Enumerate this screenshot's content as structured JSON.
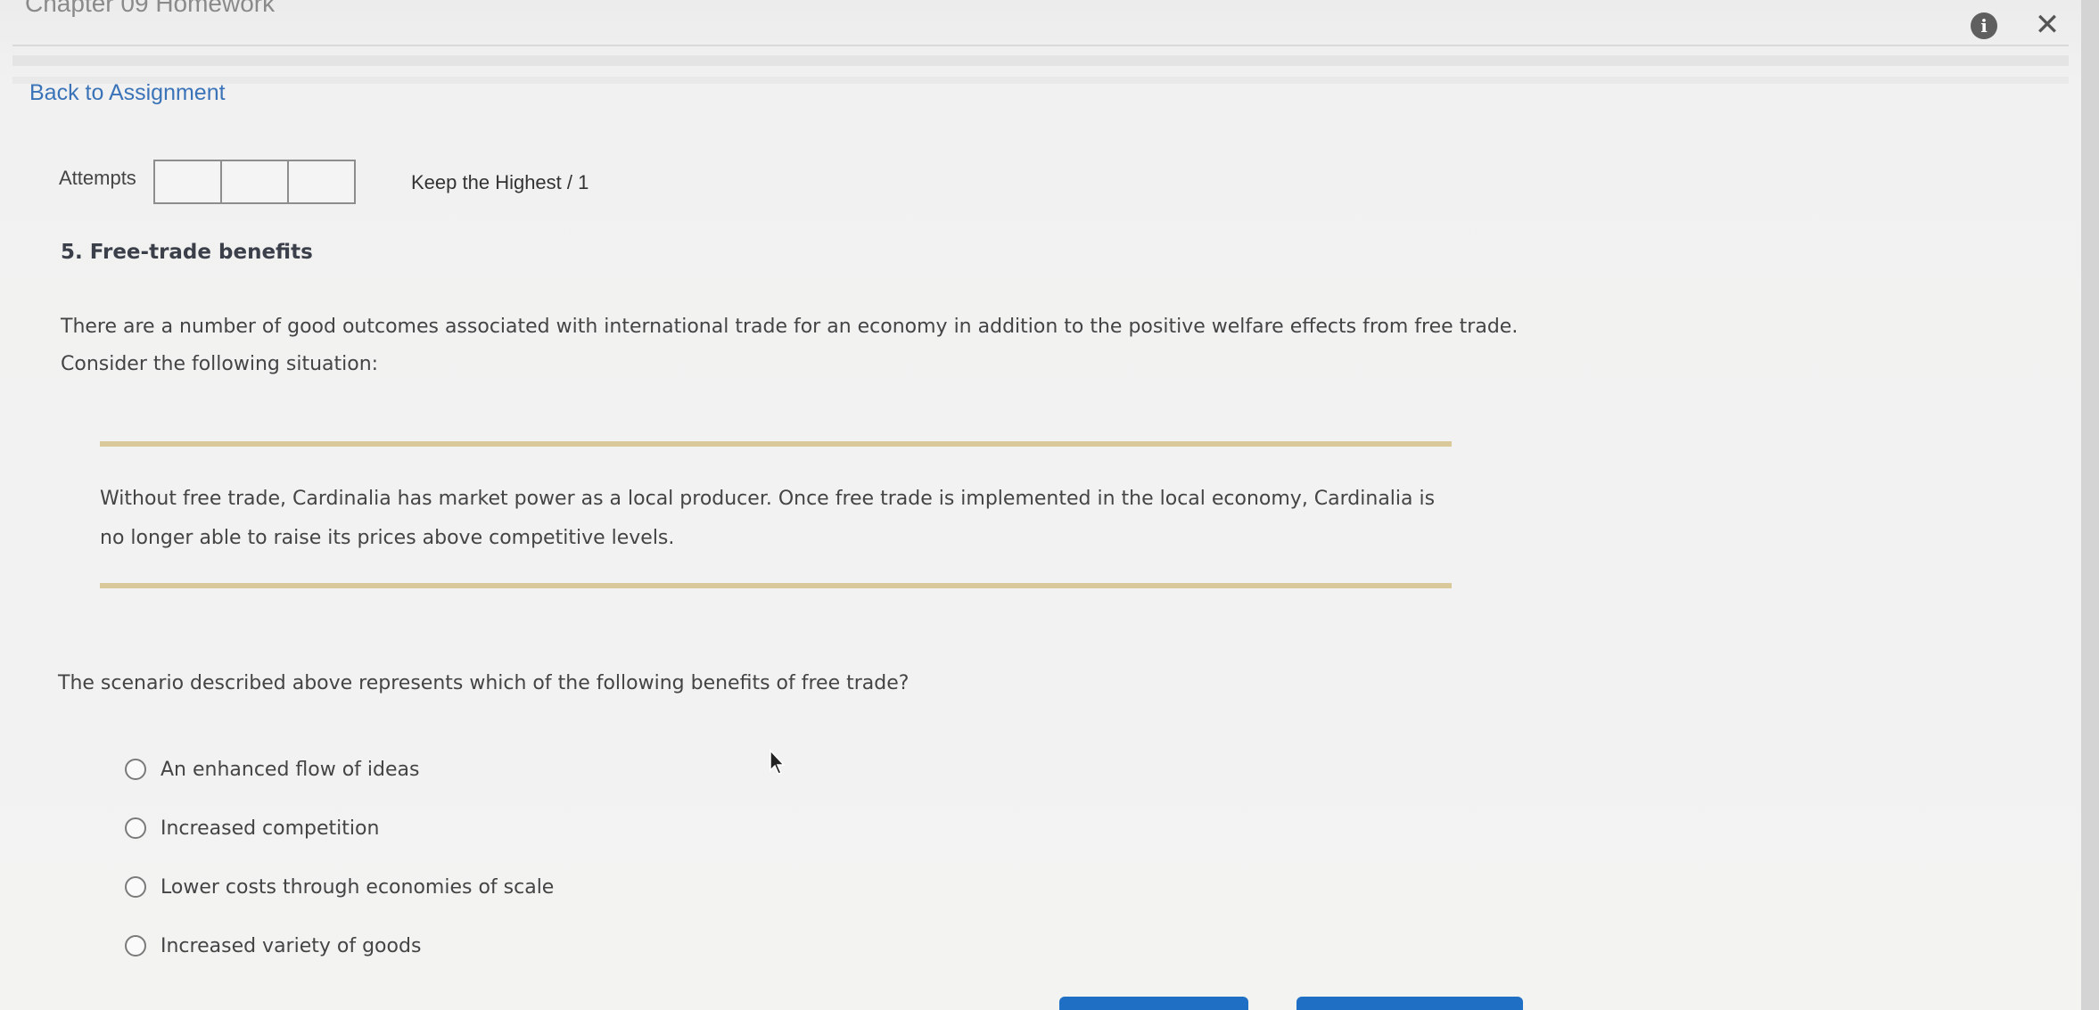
{
  "window": {
    "title": "Chapter 09 Homework",
    "info_icon": "info-icon",
    "close_icon": "close-icon",
    "close_glyph": "✕",
    "info_glyph": "i"
  },
  "nav": {
    "back_link": "Back to Assignment"
  },
  "attempts": {
    "label": "Attempts",
    "boxes": [
      "",
      "",
      ""
    ],
    "keep_highest": "Keep the Highest / 1"
  },
  "question": {
    "heading": "5. Free-trade benefits",
    "intro": "There are a number of good outcomes associated with international trade for an economy in addition to the positive welfare effects from free trade. Consider the following situation:",
    "scenario": "Without free trade, Cardinalia has market power as a local producer. Once free trade is implemented in the local economy, Cardinalia is no longer able to raise its prices above competitive levels.",
    "prompt": "The scenario described above represents which of the following benefits of free trade?",
    "options": [
      "An enhanced flow of ideas",
      "Increased competition",
      "Lower costs through economies of scale",
      "Increased variety of goods"
    ],
    "selected": null
  },
  "colors": {
    "link": "#3a73b8",
    "scenario_rule": "#d9c89a",
    "button": "#1f6fc4"
  }
}
